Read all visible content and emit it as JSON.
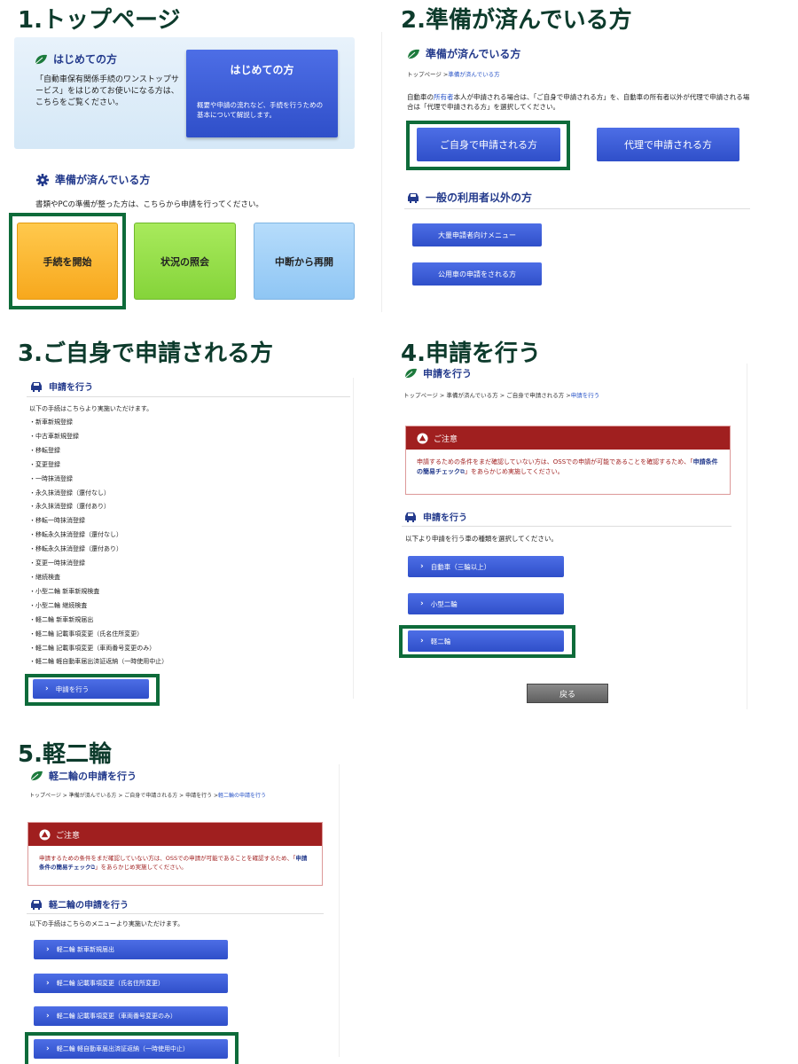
{
  "step1": {
    "title": "1.トップページ",
    "first_header": "はじめての方",
    "first_desc": "「自動車保有関係手続のワンストップサービス」をはじめてお使いになる方は、こちらをご覧ください。",
    "first_btn_title": "はじめての方",
    "first_btn_desc": "概要や申請の流れなど、手続を行うための基本について解説します。",
    "ready_header": "準備が済んでいる方",
    "ready_desc": "書類やPCの準備が整った方は、こちらから申請を行ってください。",
    "btn_start": "手続を開始",
    "btn_status": "状況の照会",
    "btn_resume": "中断から再開"
  },
  "step2": {
    "title": "2.準備が済んでいる方",
    "header": "準備が済んでいる方",
    "crumb_home": "トップページ >",
    "crumb_cur": "準備が済んでいる方",
    "desc_pre": "自動車の",
    "desc_link": "所有者",
    "desc_post": "本人が申請される場合は、「ご自身で申請される方」を、自動車の所有者以外が代理で申請される場合は「代理で申請される方」を選択してください。",
    "btn_self": "ご自身で申請される方",
    "btn_proxy": "代理で申請される方",
    "other_header": "一般の利用者以外の方",
    "btn_bulk": "大量申請者向けメニュー",
    "btn_public": "公用車の申請をされる方"
  },
  "step3": {
    "title": "3.ご自身で申請される方",
    "header": "申請を行う",
    "desc": "以下の手続はこちらより実施いただけます。",
    "items": [
      "・新車新規登録",
      "・中古車新規登録",
      "・移転登録",
      "・変更登録",
      "・一時抹消登録",
      "・永久抹消登録（還付なし）",
      "・永久抹消登録（還付あり）",
      "・移転一時抹消登録",
      "・移転永久抹消登録（還付なし）",
      "・移転永久抹消登録（還付あり）",
      "・変更一時抹消登録",
      "・継続検査",
      "・小型二輪 新車新規検査",
      "・小型二輪 継続検査",
      "・軽二輪 新車新規届出",
      "・軽二輪 記載事項変更（氏名住所変更）",
      "・軽二輪 記載事項変更（車両番号変更のみ）",
      "・軽二輪 軽自動車届出済証返納（一時使用中止）"
    ],
    "btn": "申請を行う"
  },
  "step4": {
    "title": "4.申請を行う",
    "header": "申請を行う",
    "crumb": "トップページ > 準備が済んでいる方 > ご自身で申請される方 >",
    "crumb_cur": "申請を行う",
    "caution_title": "ご注意",
    "caution_pre": "申請するための条件をまだ確認していない方は、OSSでの申請が可能であることを確認するため、「",
    "caution_link": "申請条件の簡易チェック",
    "caution_post": "」をあらかじめ実施してください。",
    "sub_header": "申請を行う",
    "sub_desc": "以下より申請を行う車の種類を選択してください。",
    "btn_car": "自動車（三輪以上）",
    "btn_small": "小型二輪",
    "btn_light": "軽二輪",
    "btn_back": "戻る"
  },
  "step5": {
    "title": "5.軽二輪",
    "header": "軽二輪の申請を行う",
    "crumb": "トップページ > 準備が済んでいる方 > ご自身で申請される方 > 申請を行う >",
    "crumb_cur": "軽二輪の申請を行う",
    "caution_title": "ご注意",
    "caution_pre": "申請するための条件をまだ確認していない方は、OSSでの申請が可能であることを確認するため、「",
    "caution_link": "申請条件の簡易チェック",
    "caution_post": "」をあらかじめ実施してください。",
    "sub_header": "軽二輪の申請を行う",
    "sub_desc": "以下の手続はこちらのメニューより実施いただけます。",
    "btns": [
      "軽二輪 新車新規届出",
      "軽二輪 記載事項変更（氏名住所変更）",
      "軽二輪 記載事項変更（車両番号変更のみ）",
      "軽二輪 軽自動車届出済証返納（一時使用中止）"
    ]
  },
  "icons": {
    "leaf": "leaf-icon",
    "gear": "gear-icon",
    "car": "car-icon",
    "warning": "warning-icon",
    "external": "external-link-icon",
    "chevron": "chevron-right-icon"
  }
}
